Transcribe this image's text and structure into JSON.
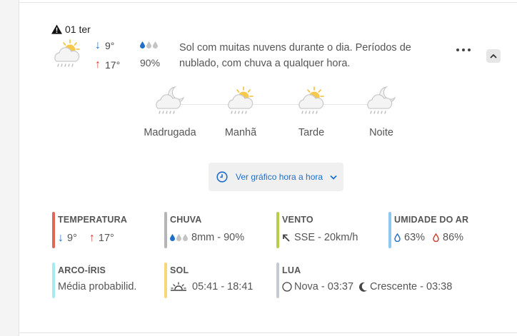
{
  "day": {
    "date_label": "01 ter"
  },
  "summary": {
    "min_temp": "9°",
    "max_temp": "17°",
    "precip_probability": "90%",
    "description": "Sol com muitas nuvens durante o dia. Períodos de nublado, com chuva a qualquer hora."
  },
  "periods": [
    {
      "label": "Madrugada",
      "icon": "moon-cloud-rain-icon"
    },
    {
      "label": "Manhã",
      "icon": "sun-cloud-rain-icon"
    },
    {
      "label": "Tarde",
      "icon": "sun-cloud-rain-icon"
    },
    {
      "label": "Noite",
      "icon": "moon-cloud-rain-icon"
    }
  ],
  "hourly_button": {
    "label": "Ver gráfico hora a hora"
  },
  "stats": {
    "temperatura": {
      "title": "TEMPERATURA",
      "min": "9°",
      "max": "17°",
      "color": "#e0665a"
    },
    "chuva": {
      "title": "CHUVA",
      "value": "8mm - 90%",
      "color": "#b5b5b5"
    },
    "vento": {
      "title": "VENTO",
      "value": "SSE - 20km/h",
      "color": "#b8cf4a"
    },
    "umidade": {
      "title": "UMIDADE DO AR",
      "min": "63%",
      "max": "86%",
      "color": "#8ec8ee"
    },
    "arco_iris": {
      "title": "ARCO-ÍRIS",
      "value": "Média probabilid.",
      "color": "#a9e9f0"
    },
    "sol": {
      "title": "SOL",
      "value": "05:41 - 18:41",
      "color": "#f6d77a"
    },
    "lua": {
      "title": "LUA",
      "phase1": "Nova - 03:37",
      "phase2": "Crescente - 03:38",
      "color": "#c6cbd1"
    }
  }
}
